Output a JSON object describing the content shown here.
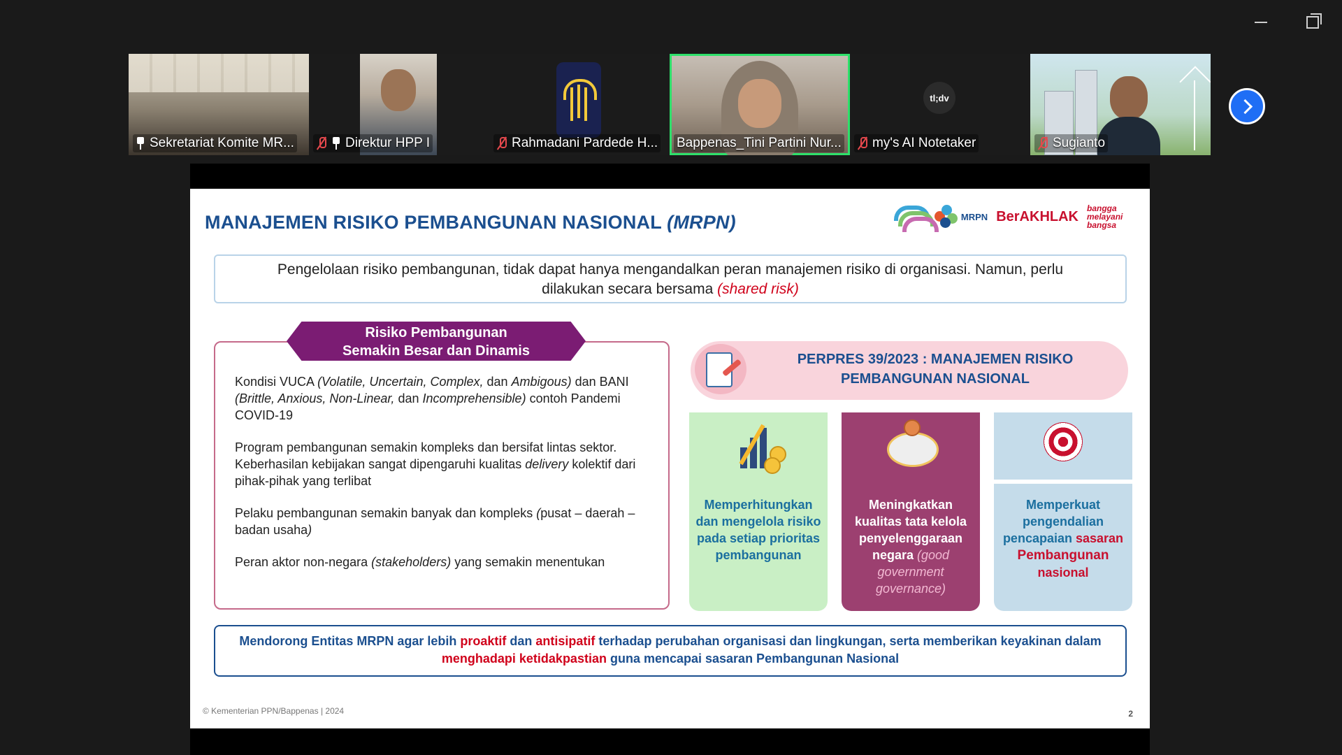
{
  "window": {
    "minimize": "—",
    "restore": "❐"
  },
  "participants": [
    {
      "name": "Sekretariat Komite MR...",
      "muted": false,
      "pinned": true
    },
    {
      "name": "Direktur HPP I",
      "muted": true,
      "pinned": true
    },
    {
      "name": "Rahmadani Pardede H...",
      "muted": true,
      "pinned": false
    },
    {
      "name": "Bappenas_Tini Partini Nur...",
      "muted": false,
      "pinned": false,
      "active": true
    },
    {
      "name": "my's AI Notetaker",
      "muted": true,
      "pinned": false,
      "logo": "tl;dv"
    },
    {
      "name": "Sugianto",
      "muted": true,
      "pinned": false
    }
  ],
  "slide": {
    "title_main": "MANAJEMEN RISIKO PEMBANGUNAN NASIONAL ",
    "title_abbr": "(MRPN)",
    "logos": {
      "mrpn": "MRPN",
      "berakhlak": "BerAKHLAK",
      "bangga": "bangga melayani bangsa"
    },
    "intro_line1": "Pengelolaan risiko pembangunan, tidak dapat hanya mengandalkan peran manajemen risiko di organisasi. Namun, perlu",
    "intro_line2": "dilakukan secara bersama ",
    "intro_emph": "(shared risk)",
    "risk_header_line1": "Risiko Pembangunan",
    "risk_header_line2": "Semakin Besar dan Dinamis",
    "risk_items": {
      "i1": {
        "a": "Kondisi VUCA ",
        "b": "(Volatile, Uncertain, Complex,",
        "c": " dan ",
        "d": "Ambigous)",
        "e": " dan BANI ",
        "f": "(Brittle, Anxious, Non-Linear,",
        "g": " dan ",
        "h": "Incomprehensible)",
        "i": " contoh Pandemi COVID-19"
      },
      "i2": {
        "a": "Program pembangunan semakin kompleks dan bersifat lintas sektor. Keberhasilan kebijakan sangat dipengaruhi kualitas ",
        "b": "delivery",
        "c": " kolektif dari pihak-pihak yang terlibat"
      },
      "i3": {
        "a": "Pelaku pembangunan semakin banyak dan kompleks ",
        "b": "(",
        "c": "pusat – daerah – badan usaha",
        "d": ")"
      },
      "i4": {
        "a": "Peran aktor non-negara ",
        "b": "(stakeholders)",
        "c": " yang semakin menentukan"
      }
    },
    "perpres_line1": "PERPRES 39/2023 : MANAJEMEN RISIKO",
    "perpres_line2": "PEMBANGUNAN NASIONAL",
    "pillars": {
      "p1": "Memperhitungkan dan mengelola risiko pada setiap prioritas pembangunan",
      "p2_a": "Meningkatkan kualitas tata kelola penyelenggaraan negara ",
      "p2_b": "(good government governance)",
      "p3_a": "Memperkuat pengendalian pencapaian ",
      "p3_b": "sasaran",
      "p3_c": "Pembangunan",
      "p3_d": "nasional"
    },
    "bottom": {
      "a": "Mendorong Entitas MRPN agar lebih ",
      "b": "proaktif",
      "c": " dan ",
      "d": "antisipatif",
      "e": " terhadap perubahan organisasi dan lingkungan, serta memberikan keyakinan dalam ",
      "f": "menghadapi ketidakpastian",
      "g": " guna mencapai sasaran Pembangunan Nasional"
    },
    "footer": "© Kementerian PPN/Bappenas | 2024",
    "page_number": "2"
  },
  "colors": {
    "accent": "#1f6ef5",
    "active_speaker": "#2ee06a",
    "title": "#1b4f8f",
    "purple": "#7b1c73"
  }
}
